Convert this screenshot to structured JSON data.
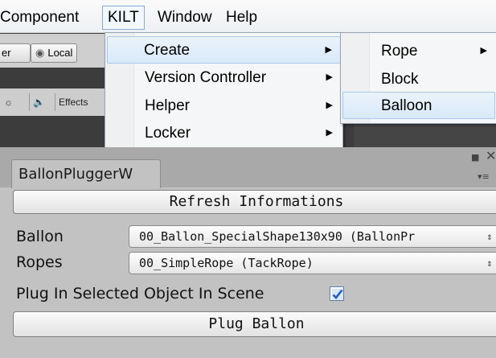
{
  "menubar": {
    "items": [
      "Component",
      "KILT",
      "Window",
      "Help"
    ]
  },
  "editor_toolbar": {
    "layer_button": "er",
    "local_button": "Local",
    "local_icon": "pivot-icon"
  },
  "scene_toolbar": {
    "sun_icon": "sun-icon",
    "audio_icon": "speaker-icon",
    "effects_label": "Effects"
  },
  "kilt_menu": {
    "items": [
      {
        "label": "Create",
        "has_submenu": true
      },
      {
        "label": "Version Controller",
        "has_submenu": true
      },
      {
        "label": "Helper",
        "has_submenu": true
      },
      {
        "label": "Locker",
        "has_submenu": true
      }
    ]
  },
  "create_submenu": {
    "items": [
      {
        "label": "Rope",
        "has_submenu": true
      },
      {
        "label": "Block",
        "has_submenu": false
      },
      {
        "label": "Balloon",
        "has_submenu": false
      }
    ]
  },
  "panel": {
    "tab_title": "BallonPluggerW",
    "refresh_button": "Refresh Informations",
    "ballon_label": "Ballon",
    "ballon_value": "00_Ballon_SpecialShape130x90 (BallonPr",
    "ropes_label": "Ropes",
    "ropes_value": "00_SimpleRope (TackRope)",
    "plug_checkbox_label": "Plug In Selected Object In Scene",
    "plug_checkbox_checked": true,
    "plug_button": "Plug Ballon"
  },
  "colors": {
    "menu_highlight": "#d9e9f9",
    "panel_bg": "#c2c2c2",
    "checkbox_check": "#1f5fbf"
  }
}
